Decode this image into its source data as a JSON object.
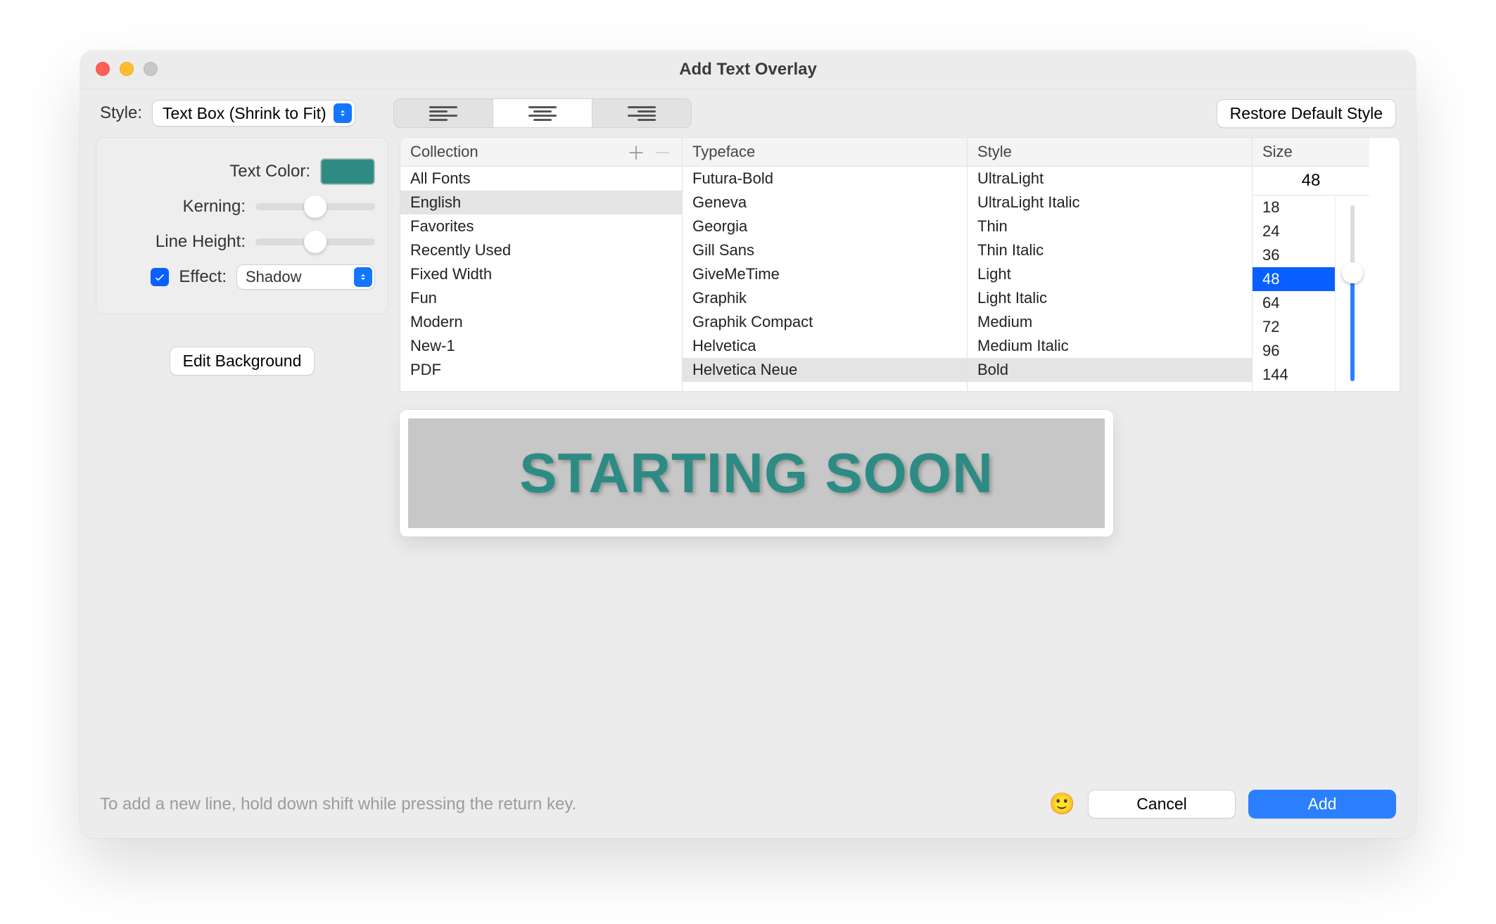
{
  "window": {
    "title": "Add Text Overlay"
  },
  "toolbar": {
    "style_label": "Style:",
    "style_value": "Text Box (Shrink to Fit)",
    "alignment": {
      "options": [
        "left",
        "center",
        "right"
      ],
      "selected": "center"
    },
    "restore_label": "Restore Default Style"
  },
  "side": {
    "text_color_label": "Text Color:",
    "text_color_value": "#2e8b84",
    "kerning_label": "Kerning:",
    "line_height_label": "Line Height:",
    "effect_label": "Effect:",
    "effect_checked": true,
    "effect_value": "Shadow",
    "edit_background_label": "Edit Background"
  },
  "font_picker": {
    "collection": {
      "header": "Collection",
      "items": [
        "All Fonts",
        "English",
        "Favorites",
        "Recently Used",
        "Fixed Width",
        "Fun",
        "Modern",
        "New-1",
        "PDF"
      ],
      "selected": "English"
    },
    "typeface": {
      "header": "Typeface",
      "items": [
        "Futura-Bold",
        "Geneva",
        "Georgia",
        "Gill Sans",
        "GiveMeTime",
        "Graphik",
        "Graphik Compact",
        "Helvetica",
        "Helvetica Neue"
      ],
      "selected": "Helvetica Neue"
    },
    "style": {
      "header": "Style",
      "items": [
        "UltraLight",
        "UltraLight Italic",
        "Thin",
        "Thin Italic",
        "Light",
        "Light Italic",
        "Medium",
        "Medium Italic",
        "Bold"
      ],
      "selected": "Bold"
    },
    "size": {
      "header": "Size",
      "value": "48",
      "options": [
        "18",
        "24",
        "36",
        "48",
        "64",
        "72",
        "96",
        "144"
      ],
      "selected": "48"
    }
  },
  "preview": {
    "text": "STARTING SOON"
  },
  "footer": {
    "hint": "To add a new line, hold down shift while pressing the return key.",
    "emoji": "🙂",
    "cancel_label": "Cancel",
    "add_label": "Add"
  }
}
